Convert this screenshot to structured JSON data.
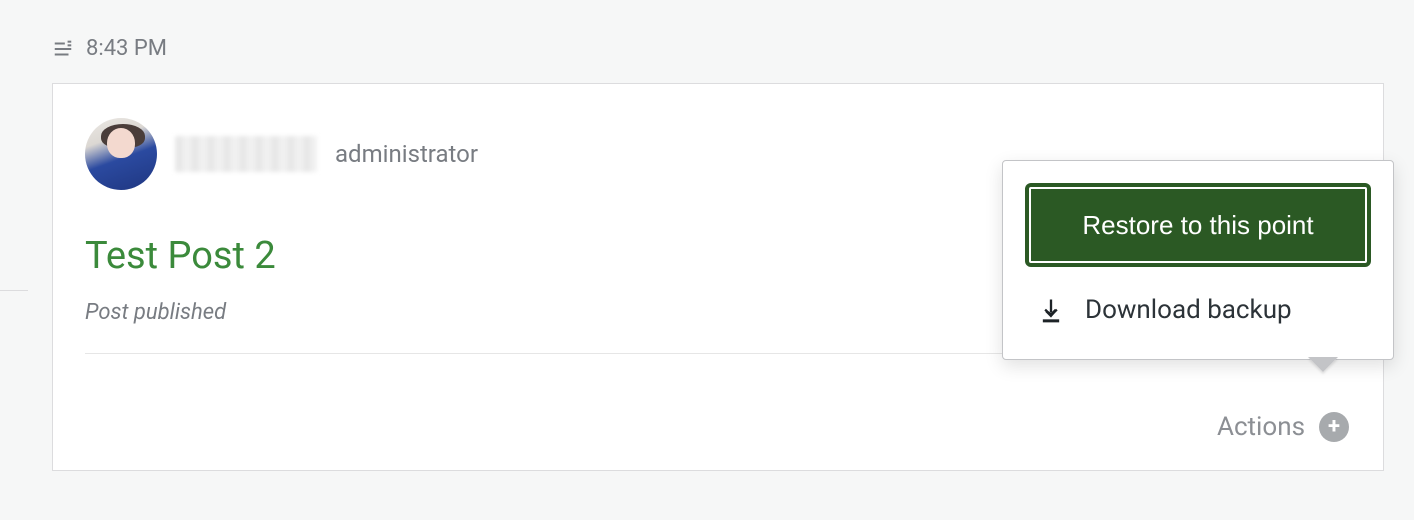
{
  "timeline": {
    "time": "8:43 PM",
    "icon": "activity-post-icon"
  },
  "entry": {
    "author": {
      "role": "administrator"
    },
    "post_title": "Test Post 2",
    "status_text": "Post published",
    "actions_label": "Actions"
  },
  "popover": {
    "restore_label": "Restore to this point",
    "download_label": "Download backup"
  }
}
